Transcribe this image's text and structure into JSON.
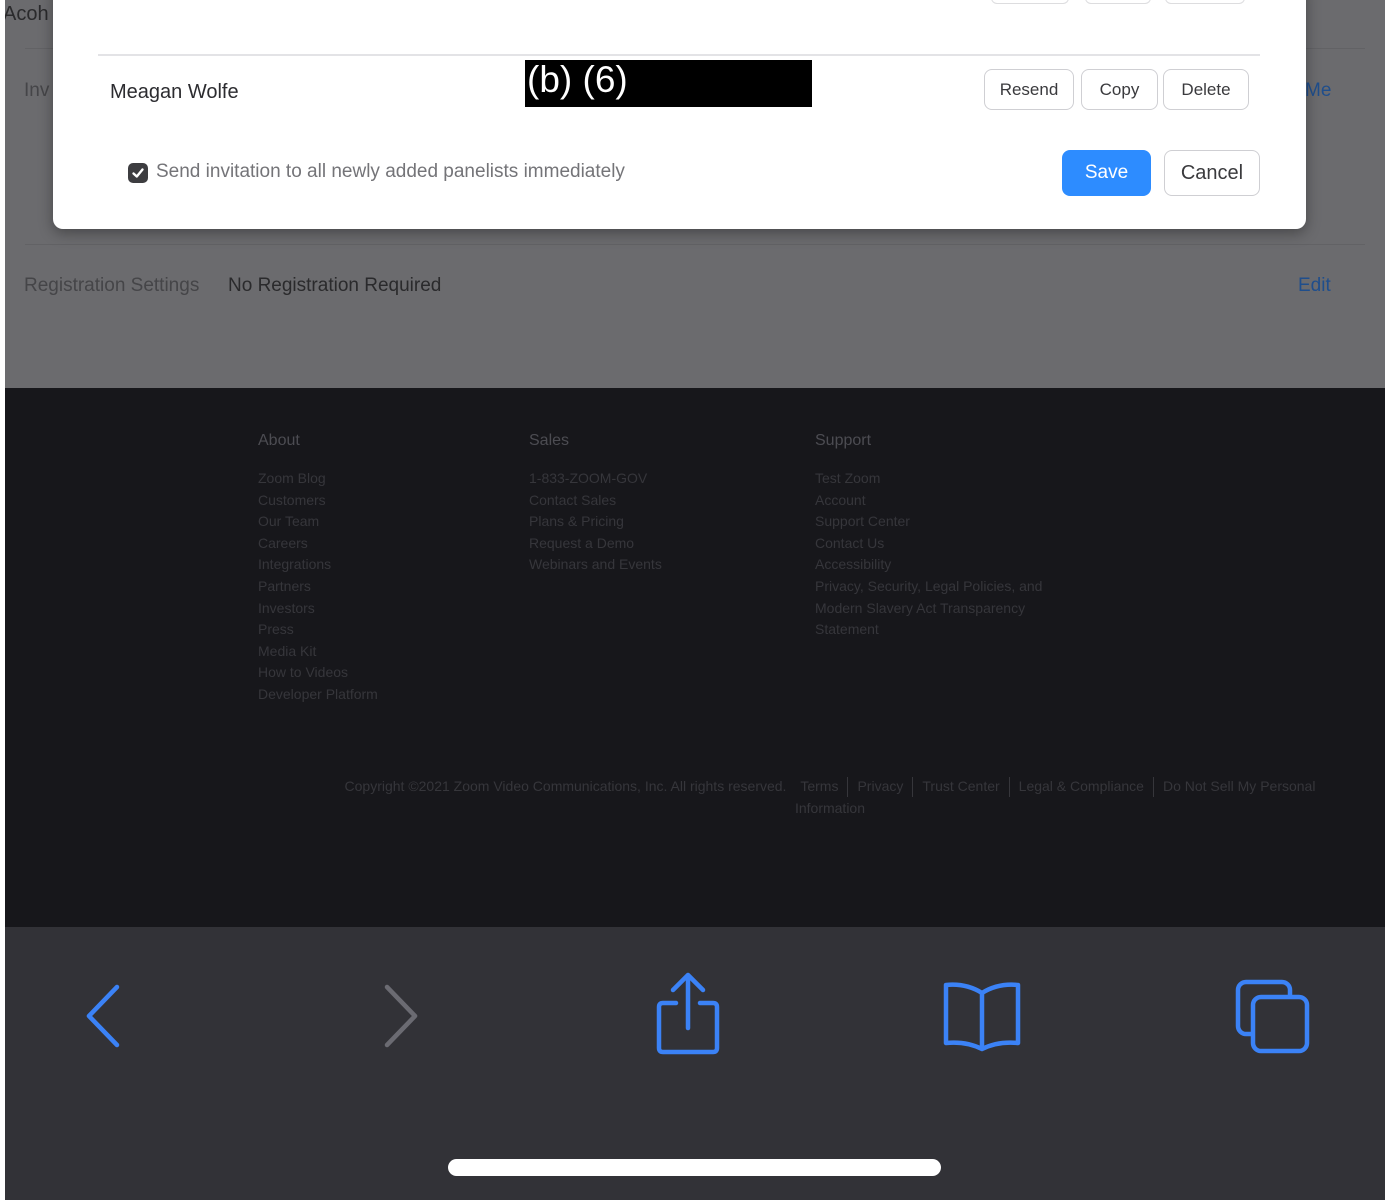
{
  "background_page": {
    "top_left_fragment": "Acoh",
    "invite_fragment": "Inv",
    "right_fragment": "Me",
    "registration": {
      "label": "Registration Settings",
      "value": "No Registration Required",
      "edit_label": "Edit"
    }
  },
  "dialog": {
    "panelist": {
      "name": "Meagan Wolfe",
      "redaction_label": "(b) (6)"
    },
    "row_actions": {
      "resend": "Resend",
      "copy": "Copy",
      "delete": "Delete"
    },
    "send_invitation": {
      "label": "Send invitation to all newly added panelists immediately",
      "checked": true
    },
    "save_label": "Save",
    "cancel_label": "Cancel"
  },
  "footer": {
    "columns": [
      {
        "heading": "About",
        "links": [
          "Zoom Blog",
          "Customers",
          "Our Team",
          "Careers",
          "Integrations",
          "Partners",
          "Investors",
          "Press",
          "Media Kit",
          "How to Videos",
          "Developer Platform"
        ]
      },
      {
        "heading": "Sales",
        "links": [
          "1-833-ZOOM-GOV",
          "Contact Sales",
          "Plans & Pricing",
          "Request a Demo",
          "Webinars and Events"
        ]
      },
      {
        "heading": "Support",
        "links": [
          "Test Zoom",
          "Account",
          "Support Center",
          "Contact Us",
          "Accessibility",
          "Privacy, Security, Legal Policies, and",
          "Modern Slavery Act Transparency",
          "Statement"
        ]
      }
    ],
    "copyright": "Copyright ©2021 Zoom Video Communications, Inc. All rights reserved.",
    "legal_links": [
      "Terms",
      "Privacy",
      "Trust Center",
      "Legal & Compliance",
      "Do Not Sell My Personal"
    ],
    "legal_links_continued": "Information"
  },
  "browser_toolbar": {
    "icons": [
      "back-icon",
      "forward-icon",
      "share-icon",
      "bookmarks-icon",
      "tabs-icon"
    ],
    "accent_color": "#3b82f6",
    "disabled_color": "#6b6b72"
  }
}
